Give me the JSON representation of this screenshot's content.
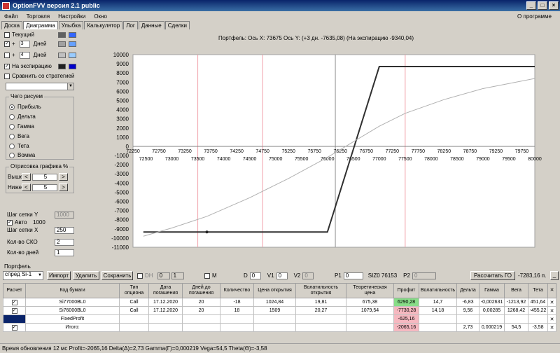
{
  "window": {
    "title": "OptionFVV версия 2.1 public",
    "min": "_",
    "max": "□",
    "close": "×"
  },
  "menu": {
    "items": [
      "Файл",
      "Торговля",
      "Настройки",
      "Окно"
    ],
    "about": "О программе"
  },
  "tabs": [
    "Доска",
    "Диаграмма",
    "Улыбка",
    "Калькулятор",
    "Лог",
    "Данные",
    "Сделки"
  ],
  "left": {
    "current_label": "Текущий",
    "plus1": {
      "sign": "+",
      "value": "3",
      "unit": "Дней",
      "checked": "✓"
    },
    "plus2": {
      "sign": "+",
      "value": "4",
      "unit": "Дней"
    },
    "expiry_label": "На экспирацию",
    "expiry_checked": "✓",
    "compare_label": "Сравнить со стратегией",
    "what_title": "Чего рисуем",
    "radios": [
      "Прибыль",
      "Дельта",
      "Гамма",
      "Вега",
      "Тета",
      "Вомма"
    ],
    "render_title": "Отрисовка графика %",
    "above_label": "Выше",
    "above_value": "5",
    "below_label": "Ниже",
    "below_value": "5",
    "left_arrow": "<",
    "right_arrow": ">",
    "gridY_label": "Шаг сетки Y",
    "gridY_value": "1000",
    "auto_label": "Авто",
    "auto_checked": "✓",
    "auto_value": "1000",
    "gridX_label": "Шаг сетки X",
    "gridX_value": "250",
    "sko_label": "Кол-во СКО",
    "sko_value": "2",
    "days_label": "Кол-во дней",
    "days_value": "1",
    "colors": {
      "current_a": "#606060",
      "current_b": "#3366ff",
      "plus1_a": "#a0a0a0",
      "plus1_b": "#66a0ff",
      "plus2_a": "#c0c0c0",
      "plus2_b": "#99ccff",
      "exp_a": "#202020",
      "exp_b": "#0000cc"
    }
  },
  "chart_title": "Портфель: Ось X: 73675 Ось Y:  (+3 дн. -7635,08)  (На экспирацию -9340,04)",
  "chart_data": {
    "type": "line",
    "title": "Портфель: Ось X: 73675 Ось Y:  (+3 дн. -7635,08)  (На экспирацию -9340,04)",
    "xlim": [
      72250,
      80000
    ],
    "ylim": [
      -11000,
      10000
    ],
    "x_ticks_top": [
      "72250",
      "72750",
      "73250",
      "73750",
      "74250",
      "74750",
      "75250",
      "75750",
      "76250",
      "76750",
      "77250",
      "77750",
      "78250",
      "78750",
      "79250",
      "79750"
    ],
    "x_ticks_bottom": [
      "72500",
      "73000",
      "73500",
      "74000",
      "74500",
      "75000",
      "75500",
      "76000",
      "76500",
      "77000",
      "77500",
      "78000",
      "78500",
      "79000",
      "79500",
      "80000"
    ],
    "y_ticks": [
      "10000",
      "9000",
      "8000",
      "7000",
      "6000",
      "5000",
      "4000",
      "3000",
      "2000",
      "1000",
      "0",
      "-1000",
      "-2000",
      "-3000",
      "-4000",
      "-5000",
      "-6000",
      "-7000",
      "-8000",
      "-9000",
      "-10000",
      "-11000"
    ],
    "vlines_red": [
      73500,
      74750,
      77500
    ],
    "vline_gray": 76153,
    "series": [
      {
        "x": [
          72450,
          76000,
          77000,
          80000
        ],
        "values": [
          -9340,
          -9340,
          8700,
          8700
        ],
        "color": "#303030"
      },
      {
        "x": [
          72450,
          73000,
          73675,
          74500,
          75250,
          76000,
          76500,
          77000,
          77500,
          78250,
          79000,
          80000
        ],
        "values": [
          -9800,
          -8900,
          -7635,
          -5600,
          -3500,
          -1200,
          500,
          2200,
          3600,
          5100,
          6300,
          7400
        ],
        "color": "#b0b0b0"
      }
    ],
    "markers": [
      {
        "x": 73675,
        "y": -9340
      }
    ]
  },
  "portfolio": {
    "label": "Портфель",
    "select": "спред Si-1",
    "import_btn": "Импорт",
    "delete_btn": "Удалить",
    "save_btn": "Сохранить",
    "dh_label": "DH",
    "dh_value": "0",
    "dh_value2": "1",
    "m_label": "M",
    "d_label": "D",
    "d_value": "0",
    "v1_label": "V1",
    "v1_value": "0",
    "v2_label": "V2",
    "v2_value": "0",
    "p1_label": "P1",
    "p1_value": "0",
    "si_label": "SIZ0 76153",
    "p2_label": "P2",
    "p2_value": "0",
    "go_btn": "Рассчитать ГО",
    "go_value": "-7283,16 п.",
    "dash": "_"
  },
  "table": {
    "headers": [
      "Расчет",
      "Код бумаги",
      "Тип опциона",
      "Дата погашения",
      "Дней до погашения",
      "Количество",
      "Цена открытия",
      "Волатильность открытия",
      "Теоретическая цена",
      "Профит",
      "Волатильность",
      "Дельта",
      "Гамма",
      "Вега",
      "Тета",
      "✕"
    ],
    "rows": [
      {
        "check": "✓",
        "code": "Si77000BL0",
        "type": "Call",
        "date": "17.12.2020",
        "days": "20",
        "qty": "-18",
        "price": "1024,84",
        "vol": "19,81",
        "theo": "675,38",
        "profit": "6290,28",
        "curvol": "14,7",
        "delta": "-6,83",
        "gamma": "-0,002631",
        "vega": "-1213,92",
        "theta": "451,64",
        "x": "✕",
        "profit_class": "green"
      },
      {
        "check": "✓",
        "code": "Si76000BL0",
        "type": "Call",
        "date": "17.12.2020",
        "days": "20",
        "qty": "18",
        "price": "1509",
        "vol": "20,27",
        "theo": "1079,54",
        "profit": "-7730,28",
        "curvol": "14,18",
        "delta": "9,56",
        "gamma": "0,00285",
        "vega": "1268,42",
        "theta": "-455,22",
        "x": "✕",
        "profit_class": "pink"
      },
      {
        "check": "",
        "code": "FixedProfit",
        "type": "",
        "date": "",
        "days": "",
        "qty": "",
        "price": "",
        "vol": "",
        "theo": "",
        "profit": "-625,16",
        "curvol": "",
        "delta": "",
        "gamma": "",
        "vega": "",
        "theta": "",
        "x": "✕",
        "profit_class": "pink"
      },
      {
        "check": "✓",
        "code": "Итого:",
        "type": "",
        "date": "",
        "days": "",
        "qty": "",
        "price": "",
        "vol": "",
        "theo": "",
        "profit": "-2065,16",
        "curvol": "",
        "delta": "2,73",
        "gamma": "0,000219",
        "vega": "54,5",
        "theta": "-3,58",
        "x": "✕",
        "profit_class": "pink"
      }
    ]
  },
  "status": "Время обновления 12 мс  Profit=-2065,16 Delta(Δ)=2,73 Gamma(Γ)=0,000219 Vega=54,5 Theta(Θ)=-3,58"
}
